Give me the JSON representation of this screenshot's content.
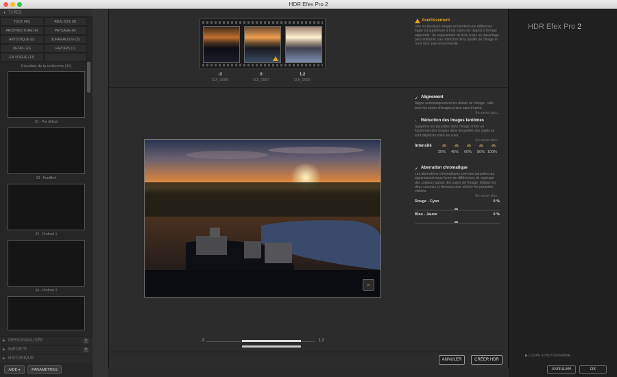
{
  "window": {
    "title": "HDR Efex Pro 2"
  },
  "left": {
    "types_label": "TYPES",
    "categories": [
      "TOUT (40)",
      "RÉALISTE (9)",
      "ARCHITECTURE (4)",
      "PAYSAGE (4)",
      "ARTISTIQUE (6)",
      "SURRÉALISTE (5)",
      "DÉTAILLÉS",
      "FAVORIS (1)",
      "EN VOGUE (13)",
      ""
    ],
    "results": "Résultats de la recherche (40)",
    "thumbs": [
      "01 - Par défaut",
      "03 - Équilibré",
      "02 - Profond 1",
      "04 - Profond 2"
    ],
    "sections": [
      "PERSONNALISÉE",
      "IMPORTÉ",
      "HISTORIQUE"
    ],
    "aide": "AIDE",
    "parametres": "PARAMÈTRES"
  },
  "modal": {
    "frames": [
      {
        "ev": "-3",
        "name": "DJI_0566"
      },
      {
        "ev": "0",
        "name": "DJI_0567"
      },
      {
        "ev": "1.2",
        "name": "DJI_0565"
      }
    ],
    "warning_title": "Avertissement",
    "warning_text": "Une ou plusieurs images présentent une différence égale ou supérieure à trois crans par rapport à l'image adjacente. Un espacement de trois crans ou davantage peut entraîner une réduction de la qualité de l'image et n'est donc pas recommandé.",
    "alignment_title": "Alignement",
    "alignment_text": "Aligne automatiquement les détails de l'image ; utile pour les séries d'images prises sans trépied.",
    "more": "En savoir plus...",
    "ghost_title": "Réduction des images fantômes",
    "ghost_text": "Supprime les parasites dans l'image créée en fusionnant des images dans lesquelles des sujets se sont déplacés entre les vues.",
    "intensity_label": "Intensité",
    "intensity_levels": [
      "20%",
      "40%",
      "60%",
      "80%",
      "100%"
    ],
    "chroma_title": "Aberration chromatique",
    "chroma_text": "Les aberrations chromatiques sont des parasites qui apparaissent sous forme de différences de repérage des couleurs autour des sujets de l'image. Utilisez les deux curseurs ci-dessous pour réduire les parasites visibles.",
    "red_cyan": "Rouge - Cyan",
    "red_cyan_val": "0 %",
    "blue_yellow": "Bleu - Jaune",
    "blue_yellow_val": "0 %",
    "slider_min": "-3",
    "slider_max": "1.2",
    "cancel": "ANNULER",
    "create": "CRÉER HDR"
  },
  "right": {
    "title_main": "HDR Efex Pro ",
    "title_num": "2",
    "loupe": "LOUPE & HISTOGRAMME",
    "annuler": "ANNULER",
    "ok": "OK"
  },
  "colors": {
    "accent": "#e8a020",
    "panel": "#2c2c2c"
  }
}
